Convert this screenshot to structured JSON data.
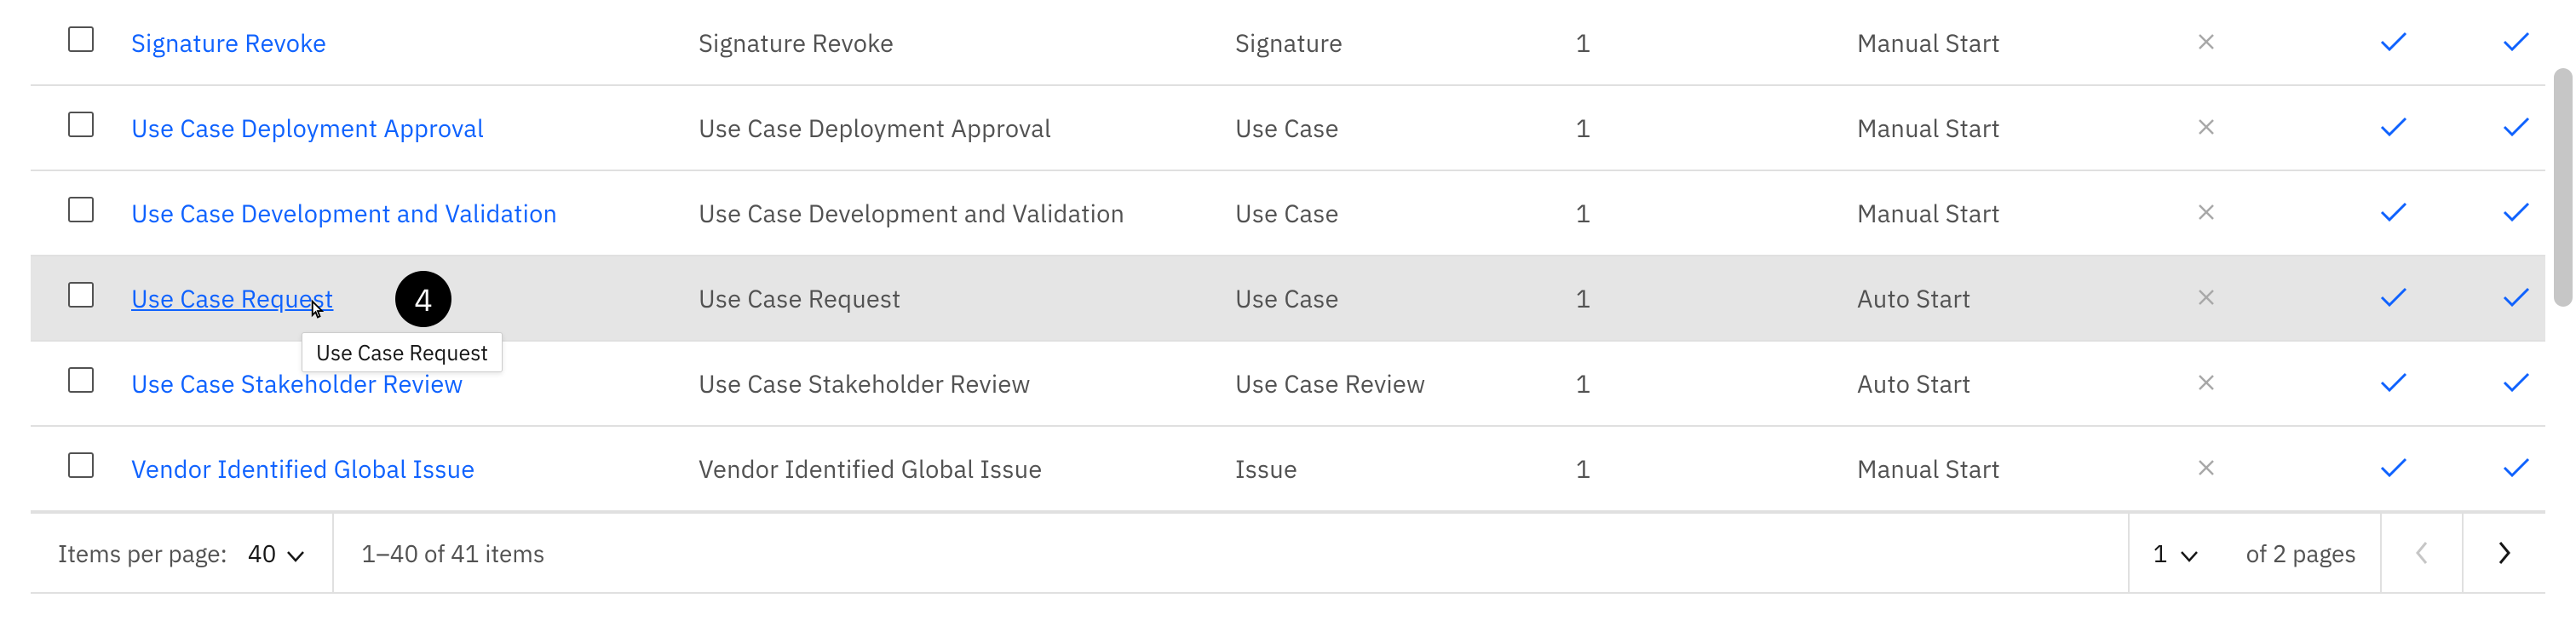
{
  "rows": [
    {
      "name": "Signature Revoke",
      "desc": "Signature Revoke",
      "type": "Signature",
      "version": "1",
      "launch": "Manual Start",
      "highlighted": false,
      "underline": false
    },
    {
      "name": "Use Case Deployment Approval",
      "desc": "Use Case Deployment Approval",
      "type": "Use Case",
      "version": "1",
      "launch": "Manual Start",
      "highlighted": false,
      "underline": false
    },
    {
      "name": "Use Case Development and Validation",
      "desc": "Use Case Development and Validation",
      "type": "Use Case",
      "version": "1",
      "launch": "Manual Start",
      "highlighted": false,
      "underline": false
    },
    {
      "name": "Use Case Request",
      "desc": "Use Case Request",
      "type": "Use Case",
      "version": "1",
      "launch": "Auto Start",
      "highlighted": true,
      "underline": true
    },
    {
      "name": "Use Case Stakeholder Review",
      "desc": "Use Case Stakeholder Review",
      "type": "Use Case Review",
      "version": "1",
      "launch": "Auto Start",
      "highlighted": false,
      "underline": false
    },
    {
      "name": "Vendor Identified Global Issue",
      "desc": "Vendor Identified Global Issue",
      "type": "Issue",
      "version": "1",
      "launch": "Manual Start",
      "highlighted": false,
      "underline": false
    }
  ],
  "annotation": {
    "number": "4",
    "tooltip": "Use Case Request"
  },
  "pagination": {
    "items_per_page_label": "Items per page:",
    "items_per_page_value": "40",
    "range_text": "1–40 of 41 items",
    "page_number": "1",
    "of_pages": "of 2 pages"
  }
}
